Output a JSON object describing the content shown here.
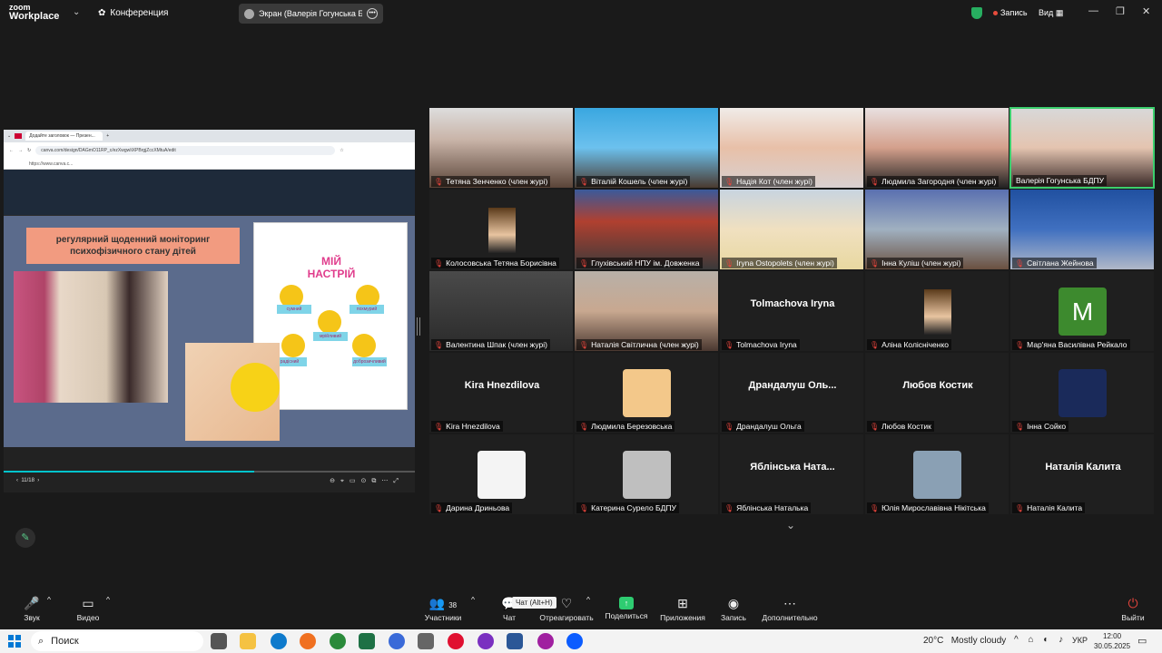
{
  "zoom": {
    "logo_top": "zoom",
    "logo_bottom": "Workplace",
    "conference_label": "Конференция",
    "screen_share_label": "Экран (Валерія Гогунська БДПУ)",
    "record_label": "Запись",
    "view_label": "Вид"
  },
  "browser": {
    "tab_title": "Додайте заголовок — Презен...",
    "url": "canva.com/design/DAGmO11RP_c/ezXwgwIiXPBrgjZccXMtuA/edit",
    "bookmark": "https://www.canva.c..."
  },
  "slide": {
    "title": "регулярний щоденний моніторинг психофізичного стану дітей",
    "poster_title": "МІЙ НАСТРІЙ",
    "poster_labels": [
      "сумний",
      "похмурий",
      "мрійливий",
      "радісний",
      "доброзичливий"
    ],
    "pager": "11/18"
  },
  "participants": [
    {
      "name": "Тетяна Зенченко (член журі)",
      "kind": "video",
      "cls": "v1"
    },
    {
      "name": "Віталій Кошель (член журі)",
      "kind": "video",
      "cls": "v2"
    },
    {
      "name": "Надія Кот (член журі)",
      "kind": "video",
      "cls": "v3"
    },
    {
      "name": "Людмила Загородня (член журі)",
      "kind": "video",
      "cls": "v4"
    },
    {
      "name": "Валерія Гогунська БДПУ",
      "kind": "video",
      "cls": "v5",
      "active": true,
      "unmuted": true
    },
    {
      "name": "Колосовська Тетяна Борисівна",
      "kind": "smallpic"
    },
    {
      "name": "Глухівський НПУ ім. Довженка",
      "kind": "video",
      "cls": "v7"
    },
    {
      "name": "Iryna Ostopolets (член журі)",
      "kind": "video",
      "cls": "v8"
    },
    {
      "name": "Інна Куліш (член журі)",
      "kind": "video",
      "cls": "v9"
    },
    {
      "name": "Світлана Жейнова",
      "kind": "video",
      "cls": "v10"
    },
    {
      "name": "Валентина Шпак (член журі)",
      "kind": "video",
      "cls": "v11"
    },
    {
      "name": "Наталія Світлична (член журі)",
      "kind": "video",
      "cls": "v12"
    },
    {
      "name": "Tolmachova Iryna",
      "kind": "text",
      "display": "Tolmachova Iryna"
    },
    {
      "name": "Аліна Колісніченко",
      "kind": "smallpic"
    },
    {
      "name": "Мар'яна Василівна Рейкало",
      "kind": "letter",
      "display": "M"
    },
    {
      "name": "Kira Hnezdilova",
      "kind": "text",
      "display": "Kira Hnezdilova"
    },
    {
      "name": "Людмила Березовська",
      "kind": "pic",
      "color": "#f3c88a"
    },
    {
      "name": "Драндалуш Ольга",
      "kind": "text",
      "display": "Драндалуш Оль..."
    },
    {
      "name": "Любов Костик",
      "kind": "text",
      "display": "Любов Костик"
    },
    {
      "name": "Інна Сойко",
      "kind": "pic",
      "color": "#1a2a5a"
    },
    {
      "name": "Дарина Дриньова",
      "kind": "pic",
      "color": "#f4f4f4"
    },
    {
      "name": "Катерина Сурело БДПУ",
      "kind": "pic",
      "color": "#bfbfbf"
    },
    {
      "name": "Яблінська Наталька",
      "kind": "text",
      "display": "Яблінська Ната..."
    },
    {
      "name": "Юлія Мирославівна Нікітська",
      "kind": "pic",
      "color": "#8aa0b4"
    },
    {
      "name": "Наталія Калита",
      "kind": "text",
      "display": "Наталія Калита"
    }
  ],
  "toolbar": {
    "mute": "Звук",
    "video": "Видео",
    "participants": "Участники",
    "participants_count": "38",
    "chat": "Чат",
    "chat_tooltip": "Чат (Alt+H)",
    "react": "Отреагировать",
    "share": "Поделиться",
    "apps": "Приложения",
    "record": "Запись",
    "more": "Дополнительно",
    "leave": "Выйти"
  },
  "taskbar": {
    "search": "Поиск",
    "weather_temp": "20°C",
    "weather_desc": "Mostly cloudy",
    "lang": "УКР",
    "time": "12:00",
    "date": "30.05.2025"
  },
  "colors": {
    "active_speaker": "#3ccf6e",
    "muted": "#e5443c",
    "share_green": "#2ecc71"
  }
}
